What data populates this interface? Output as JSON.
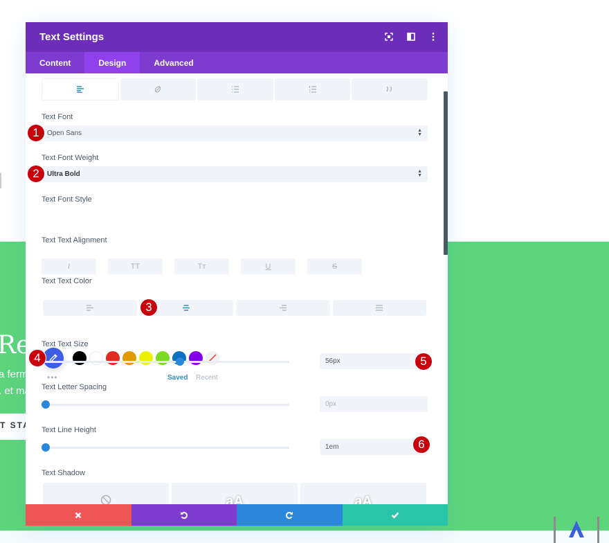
{
  "background": {
    "heading_fragment": "Rer",
    "paragraph_line1": "a ferm",
    "paragraph_line2": ". et ma",
    "button_fragment": "T STA",
    "green_color": "#5dd57b"
  },
  "modal": {
    "title": "Text Settings",
    "header_icons": [
      "focus-icon",
      "split-view-icon",
      "more-options-icon"
    ],
    "tabs": [
      {
        "label": "Content",
        "active": false
      },
      {
        "label": "Design",
        "active": true
      },
      {
        "label": "Advanced",
        "active": false
      }
    ],
    "subtabs": [
      {
        "icon": "text-align-icon",
        "active": true
      },
      {
        "icon": "link-icon",
        "active": false
      },
      {
        "icon": "unordered-list-icon",
        "active": false
      },
      {
        "icon": "ordered-list-icon",
        "active": false
      },
      {
        "icon": "quote-icon",
        "active": false
      }
    ],
    "fields": {
      "font": {
        "label": "Text Font",
        "value": "Open Sans",
        "badge": "1"
      },
      "font_weight": {
        "label": "Text Font Weight",
        "value": "Ultra Bold",
        "badge": "2"
      },
      "font_style": {
        "label": "Text Font Style",
        "options": [
          {
            "glyph": "I",
            "name": "italic"
          },
          {
            "glyph": "TT",
            "name": "uppercase"
          },
          {
            "glyph": "Tт",
            "name": "capitalize"
          },
          {
            "glyph": "U",
            "name": "underline"
          },
          {
            "glyph": "S",
            "name": "strikethrough"
          }
        ]
      },
      "alignment": {
        "label": "Text Text Alignment",
        "options": [
          "left",
          "center",
          "right",
          "justify"
        ],
        "selected": "center",
        "badge": "3"
      },
      "color": {
        "label": "Text Text Color",
        "badge": "4",
        "picker_color": "#3f5ee4",
        "swatches": [
          "#000000",
          "#ffffff",
          "#e02b20",
          "#e09900",
          "#edf000",
          "#7cda24",
          "#0c71c3",
          "#8300e9"
        ],
        "saved_label": "Saved",
        "recent_label": "Recent",
        "more_label": "•••"
      },
      "text_size": {
        "label": "Text Text Size",
        "value": "56px",
        "slider_fraction": 0.55,
        "badge": "5"
      },
      "letter_spacing": {
        "label": "Text Letter Spacing",
        "value": "0px",
        "slider_fraction": 0.0
      },
      "line_height": {
        "label": "Text Line Height",
        "value": "1em",
        "slider_fraction": 0.0,
        "badge": "6"
      },
      "text_shadow": {
        "label": "Text Shadow",
        "options": [
          "none",
          "preset-1",
          "preset-2"
        ],
        "preview_glyph": "aA"
      }
    },
    "footer": {
      "cancel_color": "#ef5555",
      "undo_color": "#7e3bd0",
      "redo_color": "#2b87da",
      "save_color": "#29c4a9"
    }
  }
}
